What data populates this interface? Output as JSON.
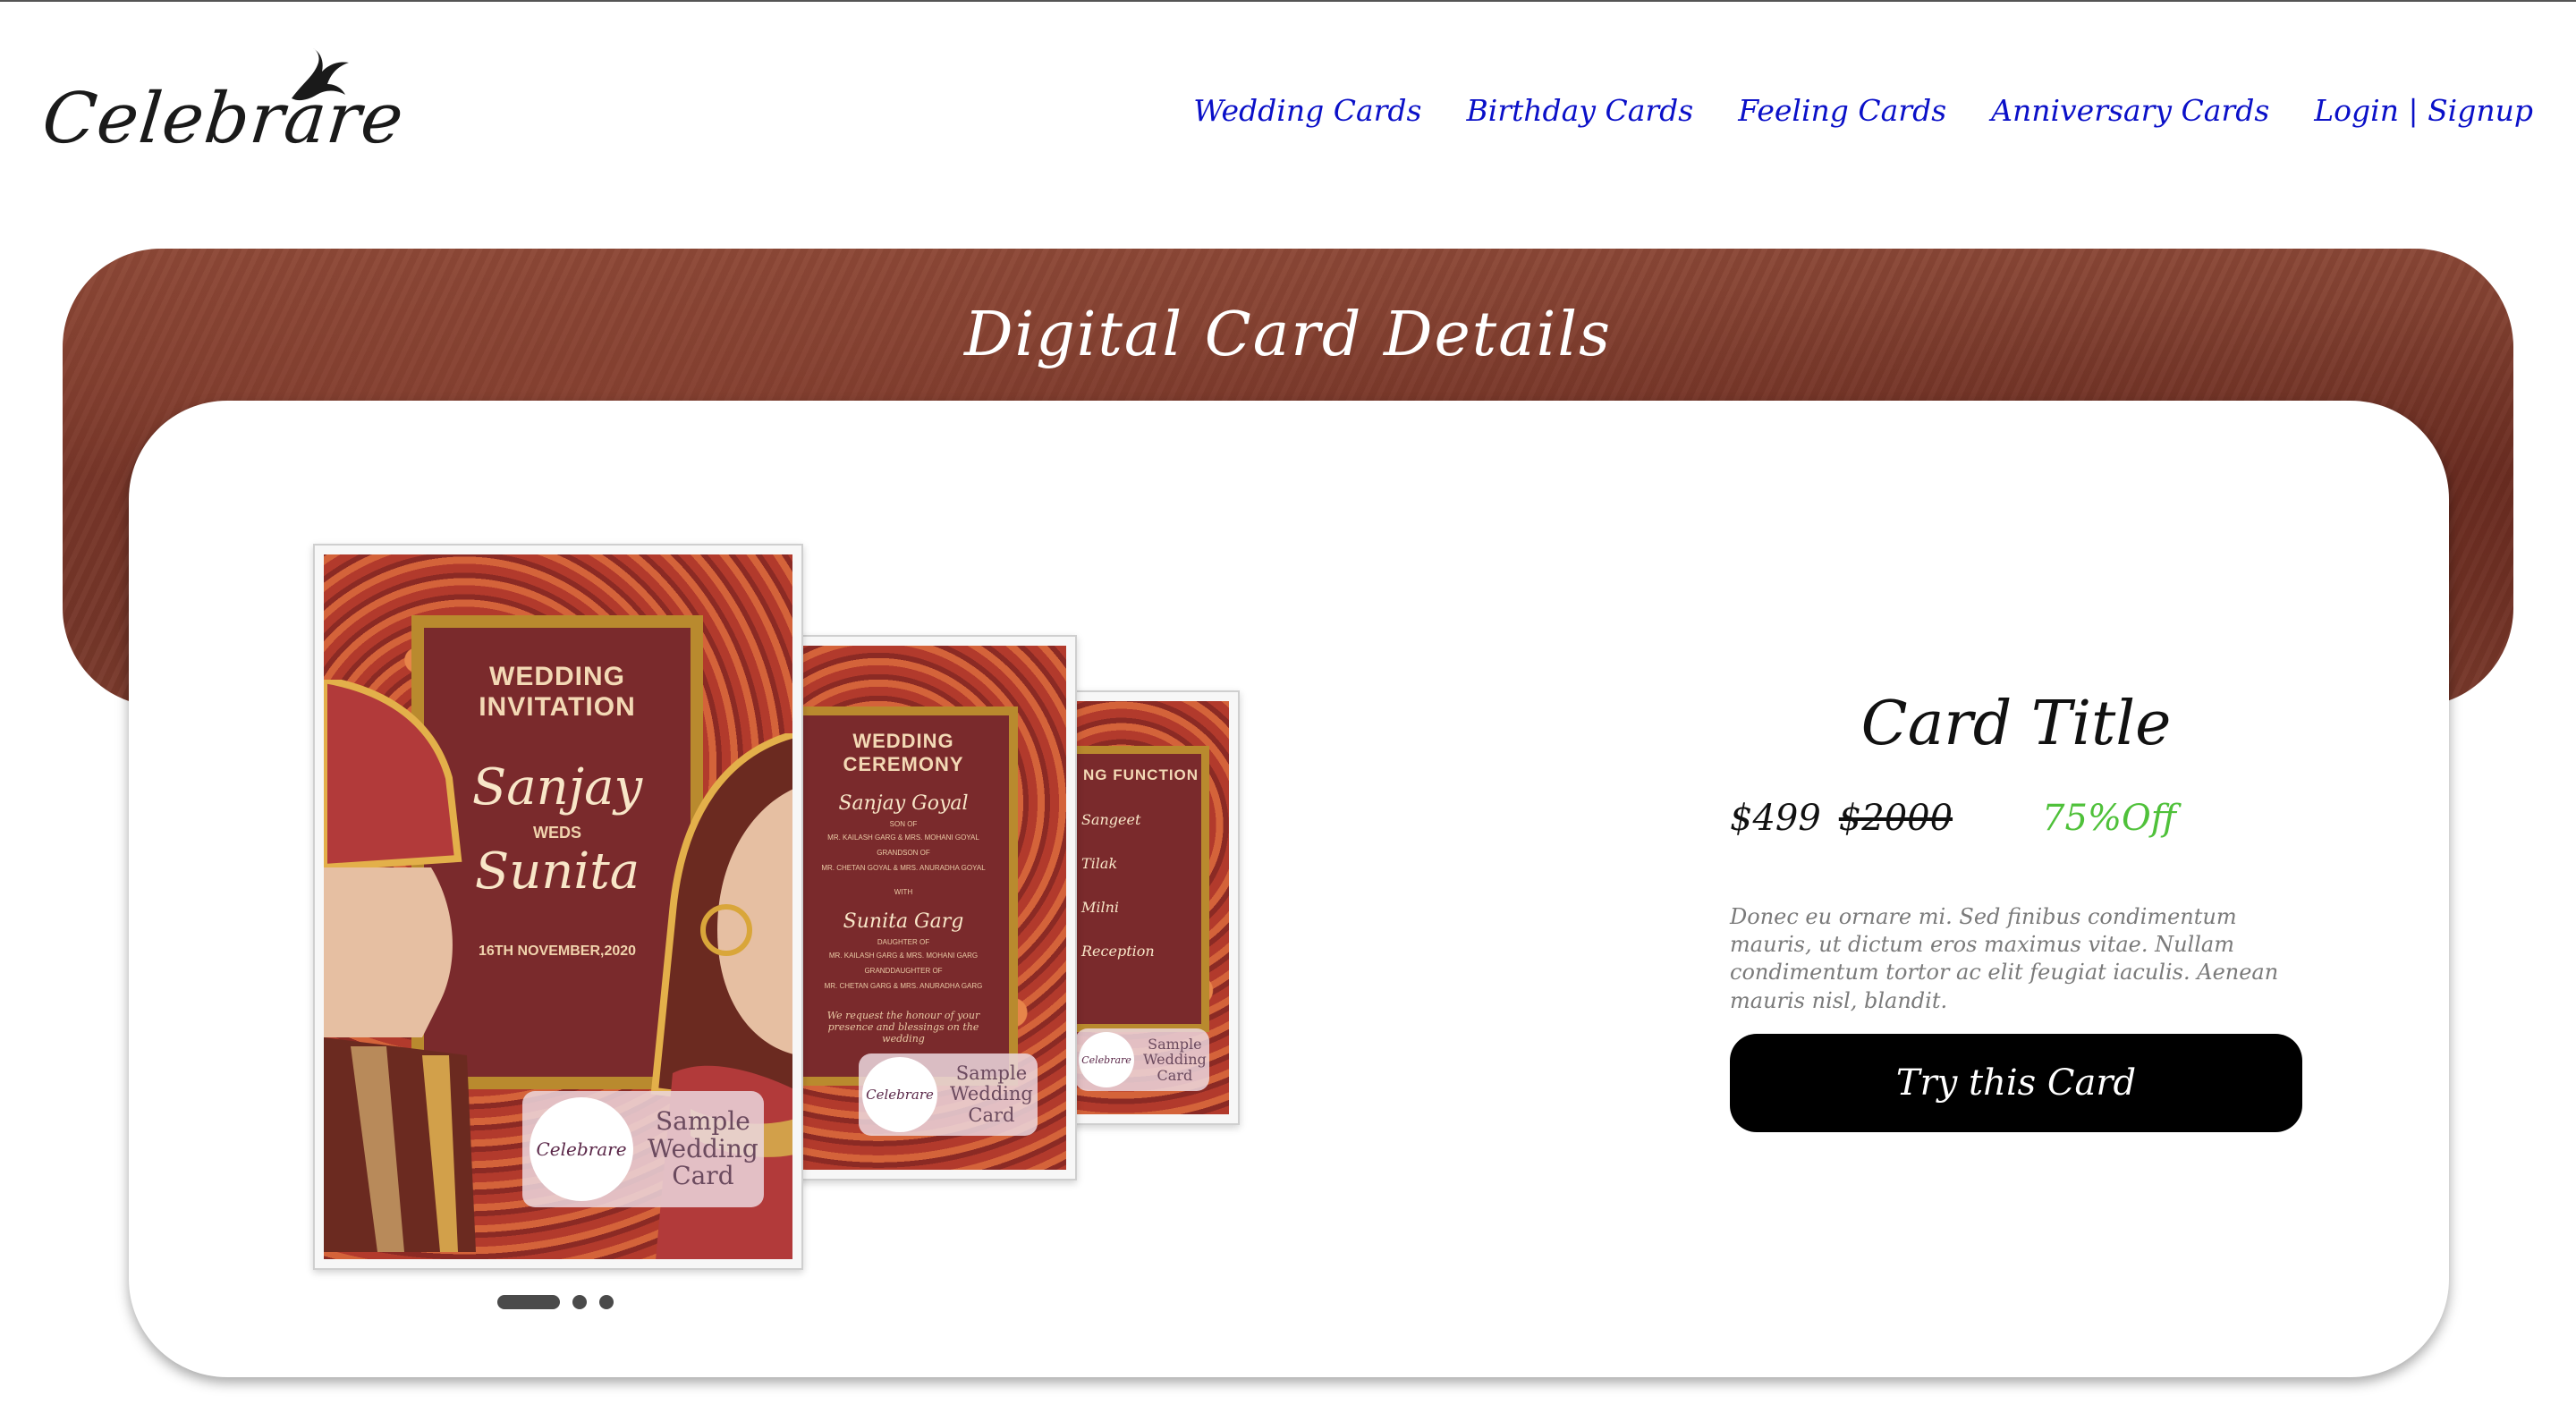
{
  "brand": {
    "logo_text": "Celebrare"
  },
  "nav": {
    "items": [
      {
        "label": "Wedding Cards"
      },
      {
        "label": "Birthday Cards"
      },
      {
        "label": "Feeling Cards"
      },
      {
        "label": "Anniversary Cards"
      },
      {
        "label": "Login | Signup"
      }
    ]
  },
  "hero": {
    "title": "Digital Card Details"
  },
  "previews": {
    "card1": {
      "heading": "WEDDING INVITATION",
      "name1": "Sanjay",
      "weds": "WEDS",
      "name2": "Sunita",
      "date": "16TH NOVEMBER,2020"
    },
    "card2": {
      "heading": "WEDDING CEREMONY",
      "groom": "Sanjay Goyal",
      "son_of": "SON OF",
      "groom_parents": "MR. KAILASH GARG & MRS. MOHANI GOYAL",
      "grandson_of": "GRANDSON OF",
      "groom_grandparents": "MR. CHETAN GOYAL & MRS. ANURADHA GOYAL",
      "with": "WITH",
      "bride": "Sunita Garg",
      "daughter_of": "DAUGHTER OF",
      "bride_parents": "MR. KAILASH GARG & MRS. MOHANI GARG",
      "granddaughter_of": "GRANDDAUGHTER OF",
      "bride_grandparents": "MR. CHETAN GARG & MRS. ANURADHA GARG",
      "request": "We request the honour of your presence and blessings on the wedding"
    },
    "card3": {
      "heading": "NG FUNCTION",
      "events": [
        "Sangeet",
        "Tilak",
        "Milni",
        "Reception"
      ]
    },
    "watermark": {
      "logo_text": "Celebrare",
      "label_line1": "Sample",
      "label_line2": "Wedding",
      "label_line3": "Card"
    }
  },
  "carousel": {
    "slides": 3,
    "active": 1
  },
  "details": {
    "title": "Card Title",
    "price": "$499",
    "original_price": "$2000",
    "discount": "75%Off",
    "description": "Donec eu ornare mi. Sed finibus condimentum mauris, ut dictum eros maximus vitae. Nullam condimentum tortor ac elit feugiat iaculis. Aenean mauris nisl, blandit.",
    "cta": "Try this Card"
  },
  "colors": {
    "nav_link": "#0a10c8",
    "hero_band": "#7a3a2c",
    "discount": "#4fc13a",
    "cta_bg": "#000000",
    "card_maroon": "#7a2a2c",
    "card_gold": "#b98a2e"
  }
}
